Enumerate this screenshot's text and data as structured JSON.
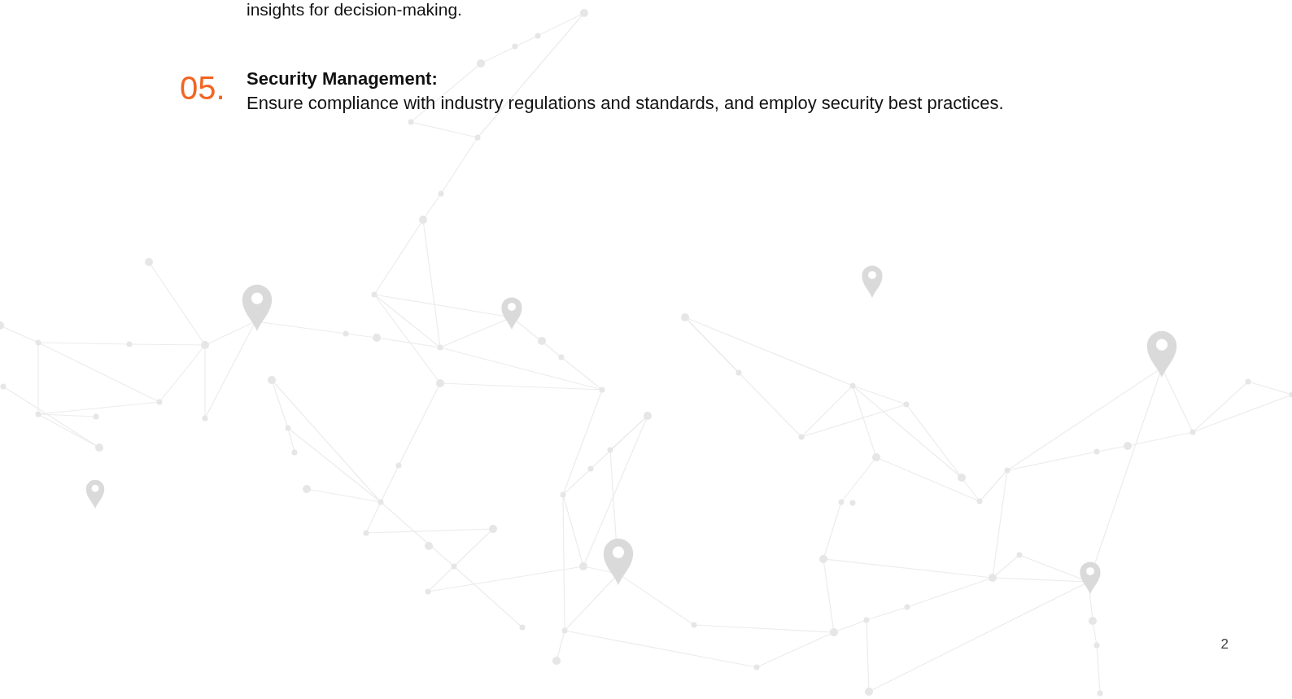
{
  "partial_text": "insights for decision-making.",
  "sections": [
    {
      "number": "05.",
      "title": "Security Management:",
      "body": "Ensure compliance with industry regulations and standards, and employ security best practices."
    }
  ],
  "page_number": "2"
}
